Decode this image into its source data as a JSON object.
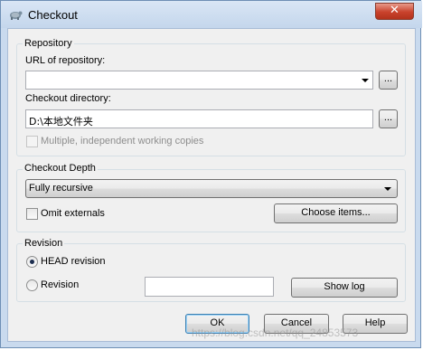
{
  "window": {
    "title": "Checkout",
    "close_glyph": "✕"
  },
  "repository": {
    "legend": "Repository",
    "url_label": "URL of repository:",
    "url_value": "",
    "browse_url_label": "...",
    "checkout_dir_label": "Checkout directory:",
    "checkout_dir_value": "D:\\本地文件夹",
    "browse_dir_label": "...",
    "multiple_copies_label": "Multiple, independent working copies"
  },
  "depth": {
    "legend": "Checkout Depth",
    "selected": "Fully recursive",
    "omit_externals_label": "Omit externals",
    "choose_items_label": "Choose items..."
  },
  "revision": {
    "legend": "Revision",
    "head_label": "HEAD revision",
    "revision_label": "Revision",
    "revision_value": "",
    "show_log_label": "Show log",
    "selected": "HEAD revision"
  },
  "buttons": {
    "ok": "OK",
    "cancel": "Cancel",
    "help": "Help"
  },
  "watermark": "https://blog.csdn.net/qq_24853573"
}
